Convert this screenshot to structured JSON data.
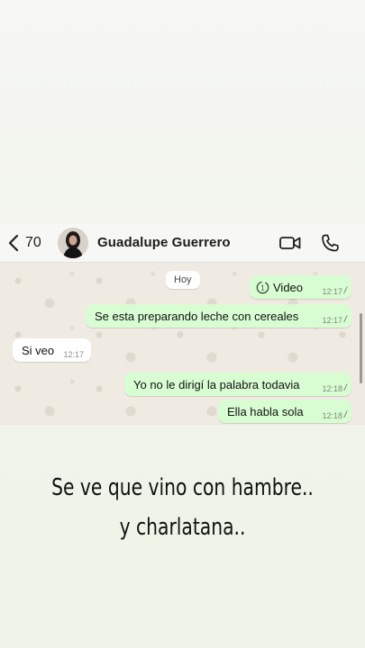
{
  "header": {
    "back_count": "70",
    "contact_name": "Guadalupe Guerrero",
    "icons": [
      "back-chevron-icon",
      "video-camera-icon",
      "phone-icon"
    ]
  },
  "chat": {
    "day_label": "Hoy",
    "messages": [
      {
        "direction": "outgoing",
        "kind": "view-once-video",
        "text": "Video",
        "time": "12:17",
        "read": true
      },
      {
        "direction": "outgoing",
        "text": "Se esta preparando leche con cereales",
        "time": "12:17",
        "read": true
      },
      {
        "direction": "incoming",
        "text": "Si veo",
        "time": "12:17"
      },
      {
        "direction": "outgoing",
        "text": "Yo no le dirigí la palabra todavia",
        "time": "12:18",
        "read": true
      },
      {
        "direction": "outgoing",
        "text": "Ella habla sola",
        "time": "12:18",
        "read": true
      }
    ]
  },
  "caption": {
    "line1": "Se ve que vino con hambre..",
    "line2": "y charlatana.."
  },
  "colors": {
    "outgoing_bubble": "#d9fdd3",
    "incoming_bubble": "#ffffff",
    "chat_background": "#efeae2"
  }
}
